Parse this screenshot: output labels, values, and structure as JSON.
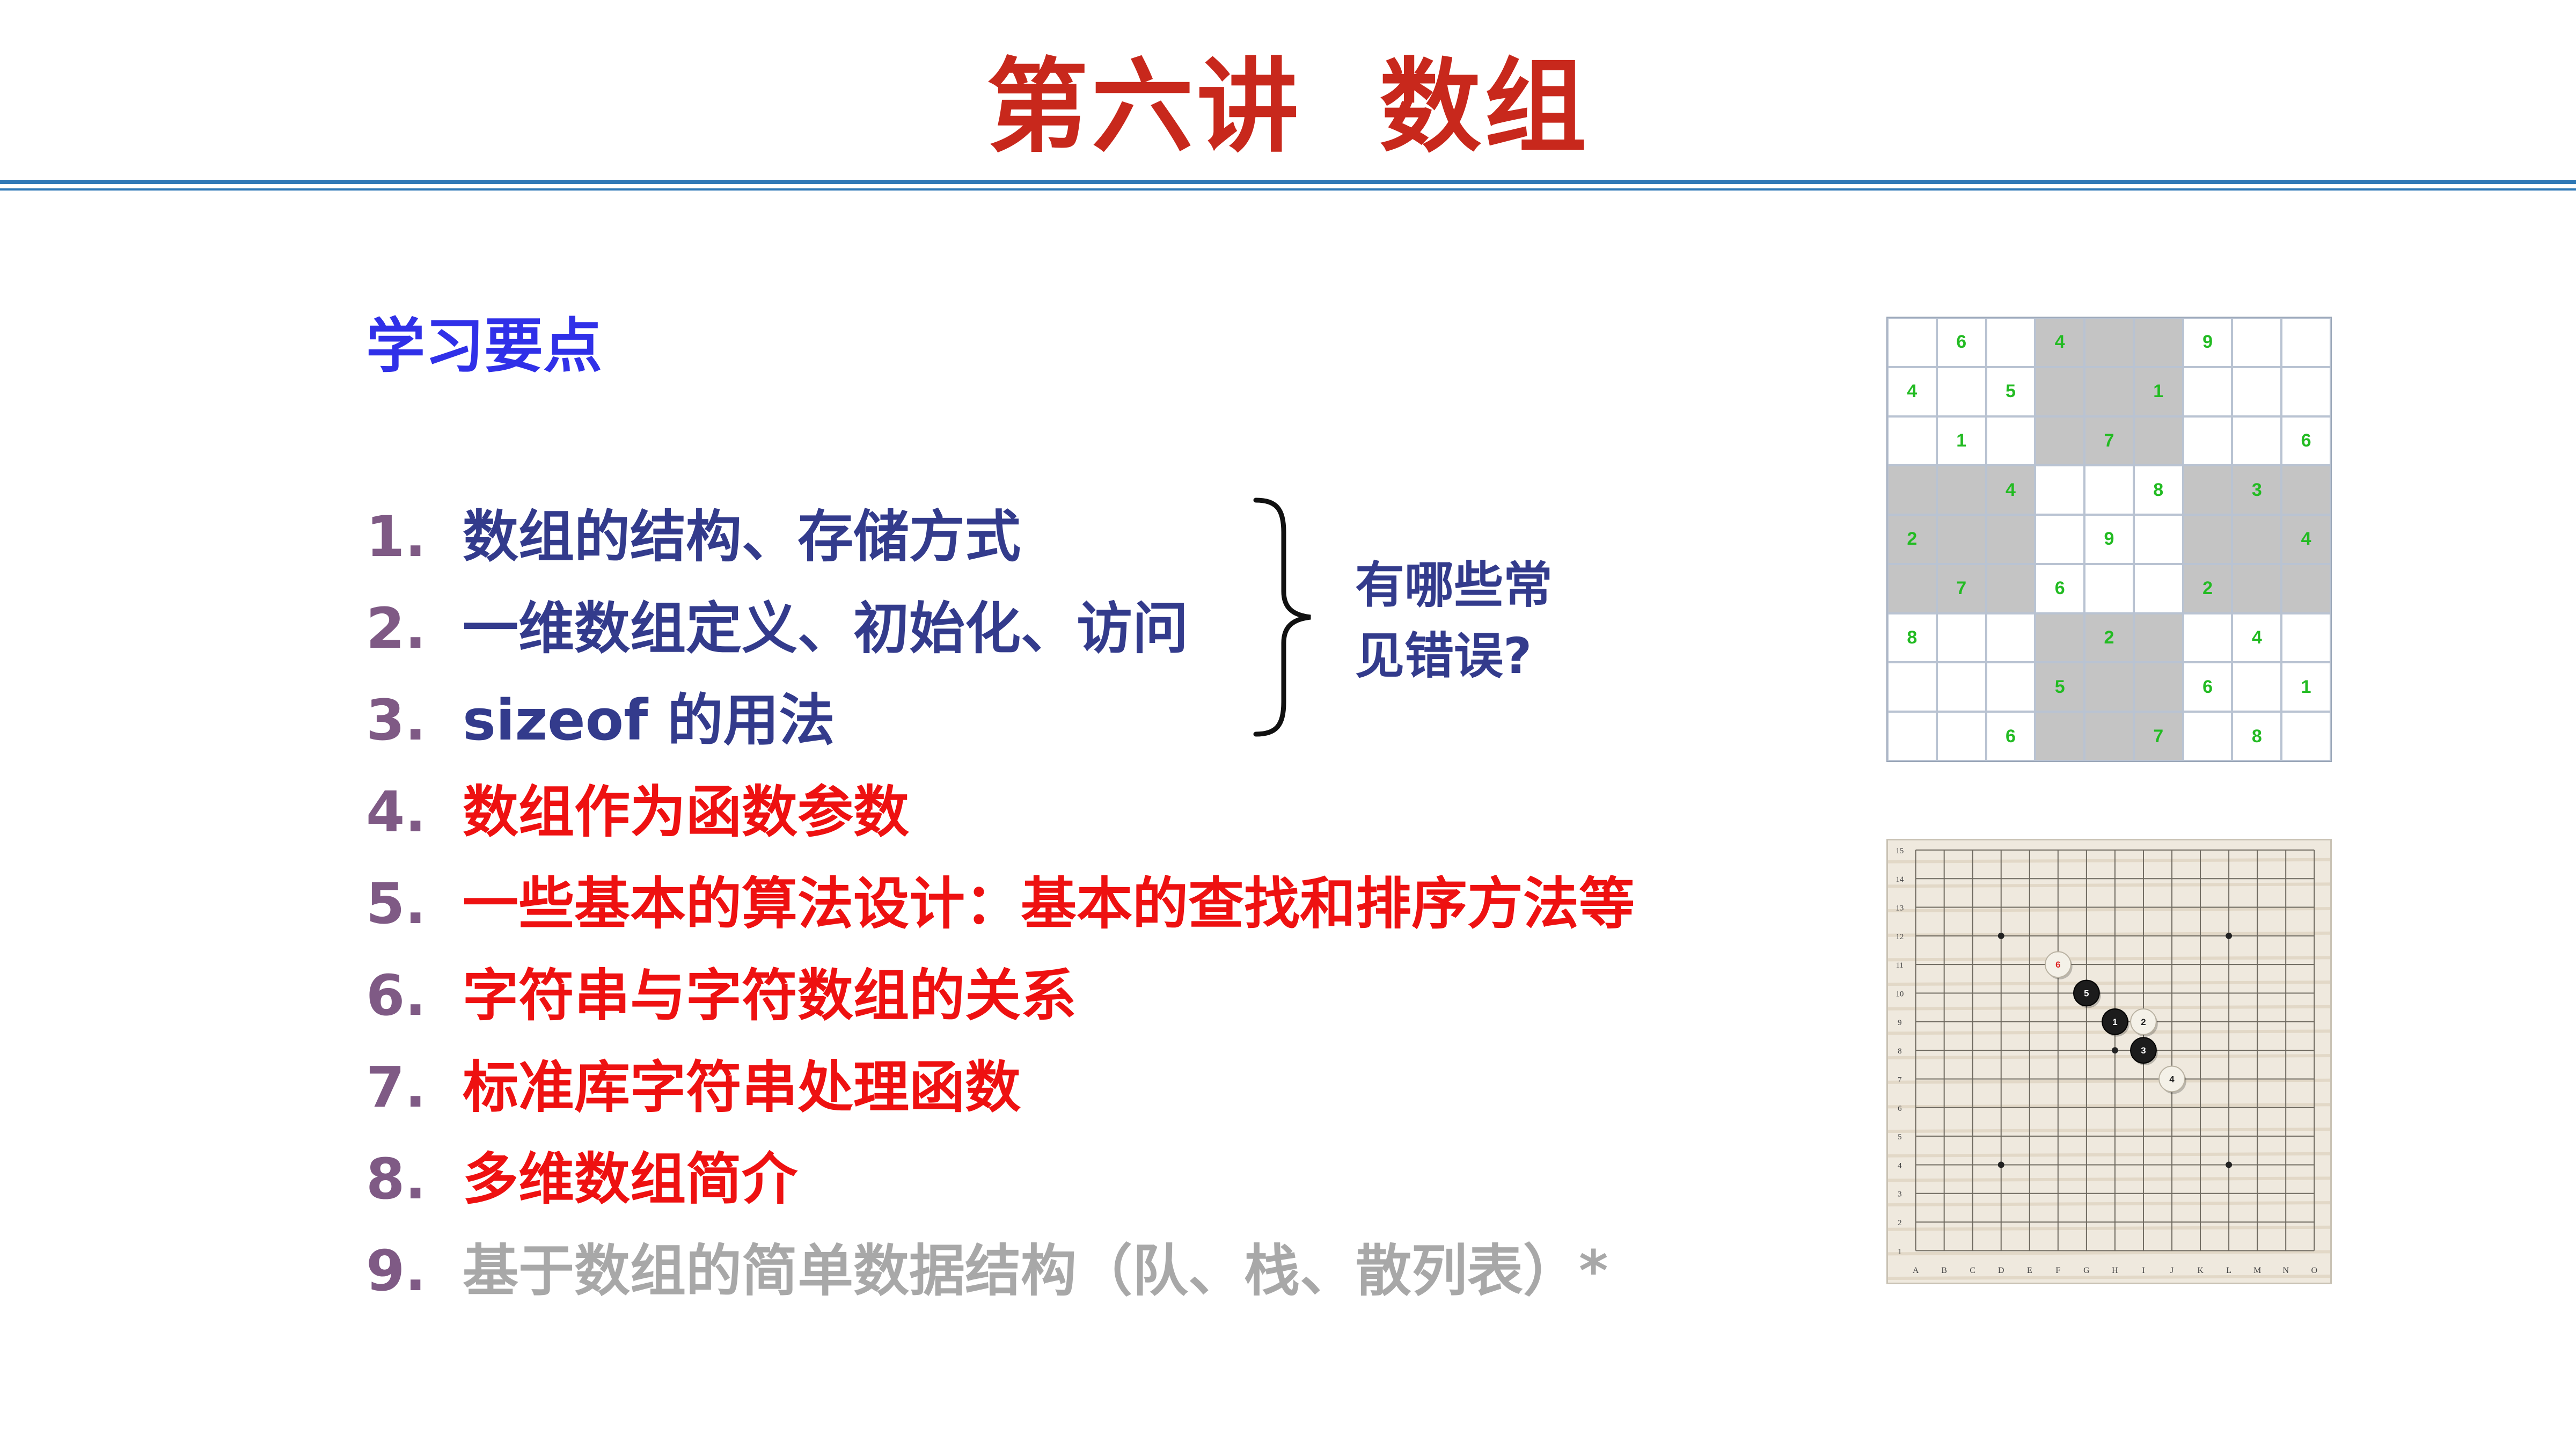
{
  "header": {
    "title": "第六讲  数组"
  },
  "main": {
    "heading": "学习要点",
    "items": [
      {
        "num": "1.",
        "text": "数组的结构、存储方式",
        "style": "navy"
      },
      {
        "num": "2.",
        "text": "一维数组定义、初始化、访问",
        "style": "navy"
      },
      {
        "num": "3.",
        "text": "sizeof 的用法",
        "style": "navy"
      },
      {
        "num": "4.",
        "text": "数组作为函数参数",
        "style": "red"
      },
      {
        "num": "5.",
        "text": "一些基本的算法设计：基本的查找和排序方法等",
        "style": "red"
      },
      {
        "num": "6.",
        "text": "字符串与字符数组的关系",
        "style": "red"
      },
      {
        "num": "7.",
        "text": "标准库字符串处理函数",
        "style": "red"
      },
      {
        "num": "8.",
        "text": "多维数组简介",
        "style": "red"
      },
      {
        "num": "9.",
        "text": "基于数组的简单数据结构（队、栈、散列表）*",
        "style": "grey"
      }
    ],
    "brace_note": {
      "line1": "有哪些常",
      "line2": "见错误?"
    }
  },
  "colors": {
    "title": "#c8281c",
    "heading": "#3030e8",
    "number": "#7f5a85",
    "navy_text": "#333b8c",
    "red_text": "#ee1111",
    "grey_text": "#a8a8a8",
    "rule": "#2f78b6",
    "sudoku_digit": "#22bb22",
    "sudoku_shade": "#c4c4c4"
  },
  "sudoku": {
    "rows": [
      [
        "",
        "6",
        "",
        "4",
        "",
        "",
        "9",
        "",
        ""
      ],
      [
        "4",
        "",
        "5",
        "",
        "",
        "1",
        "",
        "",
        ""
      ],
      [
        "",
        "1",
        "",
        "",
        "7",
        "",
        "",
        "",
        "6"
      ],
      [
        "",
        "",
        "4",
        "",
        "",
        "8",
        "",
        "3",
        ""
      ],
      [
        "2",
        "",
        "",
        "",
        "9",
        "",
        "",
        "",
        "4"
      ],
      [
        "",
        "7",
        "",
        "6",
        "",
        "",
        "2",
        "",
        ""
      ],
      [
        "8",
        "",
        "",
        "",
        "2",
        "",
        "",
        "4",
        ""
      ],
      [
        "",
        "",
        "",
        "5",
        "",
        "",
        "6",
        "",
        "1"
      ],
      [
        "",
        "",
        "6",
        "",
        "",
        "7",
        "",
        "8",
        ""
      ]
    ],
    "shaded": [
      [
        0,
        0,
        0,
        1,
        1,
        1,
        0,
        0,
        0
      ],
      [
        0,
        0,
        0,
        1,
        1,
        1,
        0,
        0,
        0
      ],
      [
        0,
        0,
        0,
        1,
        1,
        1,
        0,
        0,
        0
      ],
      [
        1,
        1,
        1,
        0,
        0,
        0,
        1,
        1,
        1
      ],
      [
        1,
        1,
        1,
        0,
        0,
        0,
        1,
        1,
        1
      ],
      [
        1,
        1,
        1,
        0,
        0,
        0,
        1,
        1,
        1
      ],
      [
        0,
        0,
        0,
        1,
        1,
        1,
        0,
        0,
        0
      ],
      [
        0,
        0,
        0,
        1,
        1,
        1,
        0,
        0,
        0
      ],
      [
        0,
        0,
        0,
        1,
        1,
        1,
        0,
        0,
        0
      ]
    ]
  },
  "gomoku": {
    "col_labels": [
      "A",
      "B",
      "C",
      "D",
      "E",
      "F",
      "G",
      "H",
      "I",
      "J",
      "K",
      "L",
      "M",
      "N",
      "O"
    ],
    "row_labels": [
      "15",
      "14",
      "13",
      "12",
      "11",
      "10",
      "9",
      "8",
      "7",
      "6",
      "5",
      "4",
      "3",
      "2",
      "1"
    ],
    "star_points": [
      {
        "col": "D",
        "row": 12
      },
      {
        "col": "L",
        "row": 12
      },
      {
        "col": "D",
        "row": 4
      },
      {
        "col": "L",
        "row": 4
      },
      {
        "col": "H",
        "row": 8
      }
    ],
    "stones": [
      {
        "col": "H",
        "row": 9,
        "color": "black",
        "label": "1"
      },
      {
        "col": "I",
        "row": 9,
        "color": "white",
        "label": "2"
      },
      {
        "col": "I",
        "row": 8,
        "color": "black",
        "label": "3"
      },
      {
        "col": "J",
        "row": 7,
        "color": "white",
        "label": "4"
      },
      {
        "col": "G",
        "row": 10,
        "color": "black",
        "label": "5"
      },
      {
        "col": "F",
        "row": 11,
        "color": "white",
        "label": "6"
      }
    ]
  }
}
